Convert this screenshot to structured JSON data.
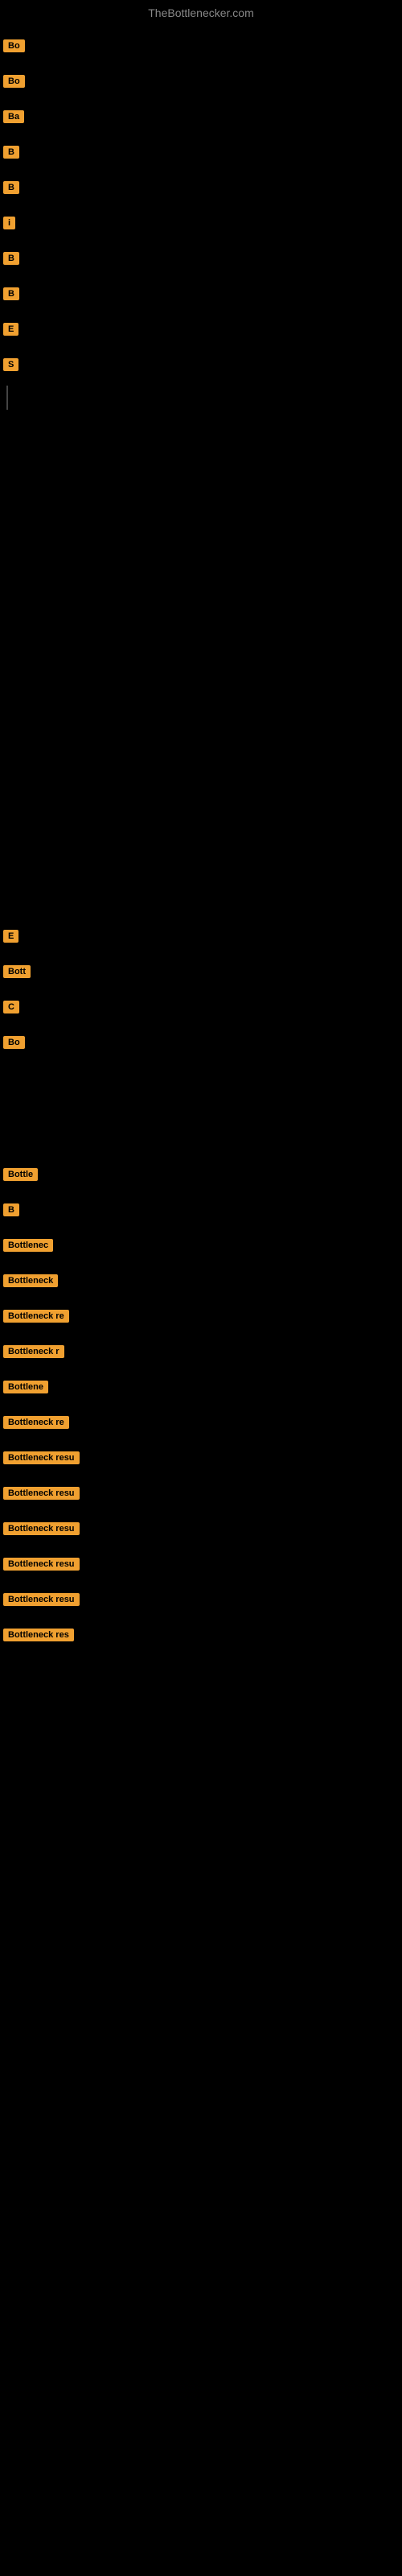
{
  "site": {
    "title": "TheBottlenecker.com"
  },
  "badges": [
    {
      "id": "b1",
      "label": "Bo",
      "text": "Bottleneck"
    },
    {
      "id": "b2",
      "label": "Bo",
      "text": "Bottleneck"
    },
    {
      "id": "b3",
      "label": "Ba",
      "text": "Balanced"
    },
    {
      "id": "b4",
      "label": "B",
      "text": "B"
    },
    {
      "id": "b5",
      "label": "B",
      "text": "B"
    },
    {
      "id": "b6",
      "label": "i",
      "text": "i"
    },
    {
      "id": "b7",
      "label": "B",
      "text": "B"
    },
    {
      "id": "b8",
      "label": "B",
      "text": "B"
    },
    {
      "id": "b9",
      "label": "E",
      "text": "E"
    },
    {
      "id": "b10",
      "label": "S",
      "text": "S"
    }
  ],
  "middle_items": [
    {
      "id": "m1",
      "label": "E",
      "text": "E"
    },
    {
      "id": "m2",
      "label": "Bott",
      "text": "Bottleneck"
    },
    {
      "id": "m3",
      "label": "C",
      "text": "C"
    },
    {
      "id": "m4",
      "label": "Bo",
      "text": "Bottleneck"
    }
  ],
  "lower_items": [
    {
      "id": "l1",
      "label": "Bottle",
      "text": "Bottleneck"
    },
    {
      "id": "l2",
      "label": "B",
      "text": "B"
    },
    {
      "id": "l3",
      "label": "Bottlenec",
      "text": "Bottleneck"
    },
    {
      "id": "l4",
      "label": "Bottleneck",
      "text": "Bottleneck"
    },
    {
      "id": "l5",
      "label": "Bottleneck re",
      "text": "Bottleneck re"
    },
    {
      "id": "l6",
      "label": "Bottleneck r",
      "text": "Bottleneck r"
    },
    {
      "id": "l7",
      "label": "Bottlene",
      "text": "Bottleneck"
    },
    {
      "id": "l8",
      "label": "Bottleneck re",
      "text": "Bottleneck re"
    },
    {
      "id": "l9",
      "label": "Bottleneck resu",
      "text": "Bottleneck resu"
    },
    {
      "id": "l10",
      "label": "Bottleneck resu",
      "text": "Bottleneck resu"
    },
    {
      "id": "l11",
      "label": "Bottleneck resu",
      "text": "Bottleneck resu"
    },
    {
      "id": "l12",
      "label": "Bottleneck resu",
      "text": "Bottleneck resu"
    },
    {
      "id": "l13",
      "label": "Bottleneck resu",
      "text": "Bottleneck resu"
    },
    {
      "id": "l14",
      "label": "Bottleneck re",
      "text": "Bottleneck re"
    }
  ]
}
